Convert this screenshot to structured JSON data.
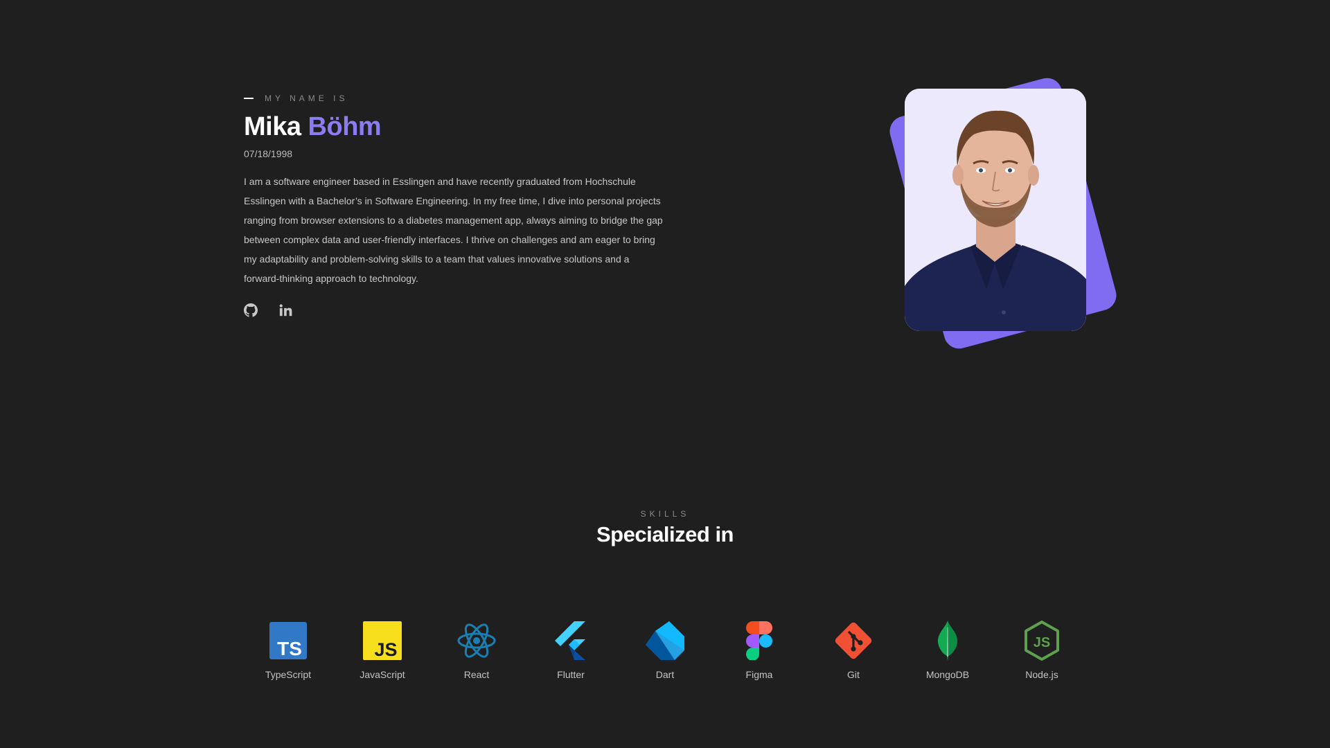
{
  "hero": {
    "eyebrow": "MY NAME IS",
    "first_name": "Mika",
    "last_name": "Böhm",
    "dob": "07/18/1998",
    "bio": "I am a software engineer based in Esslingen and have recently graduated from Hochschule Esslingen with a Bachelor’s in Software Engineering. In my free time, I dive into personal projects ranging from browser extensions to a diabetes management app, always aiming to bridge the gap between complex data and user-friendly interfaces. I thrive on challenges and am eager to bring my adaptability and problem-solving skills to a team that values innovative solutions and a forward-thinking approach to technology.",
    "socials": [
      {
        "icon": "github-icon"
      },
      {
        "icon": "linkedin-icon"
      }
    ]
  },
  "colors": {
    "background": "#1f1f1f",
    "accent": "#8b7cf4",
    "portrait_card": "#7f6cf0"
  },
  "skills": {
    "eyebrow": "SKILLS",
    "title": "Specialized in",
    "items": [
      {
        "label": "TypeScript",
        "icon": "typescript-icon"
      },
      {
        "label": "JavaScript",
        "icon": "javascript-icon"
      },
      {
        "label": "React",
        "icon": "react-icon"
      },
      {
        "label": "Flutter",
        "icon": "flutter-icon"
      },
      {
        "label": "Dart",
        "icon": "dart-icon"
      },
      {
        "label": "Figma",
        "icon": "figma-icon"
      },
      {
        "label": "Git",
        "icon": "git-icon"
      },
      {
        "label": "MongoDB",
        "icon": "mongodb-icon"
      },
      {
        "label": "Node.js",
        "icon": "nodejs-icon"
      }
    ]
  }
}
